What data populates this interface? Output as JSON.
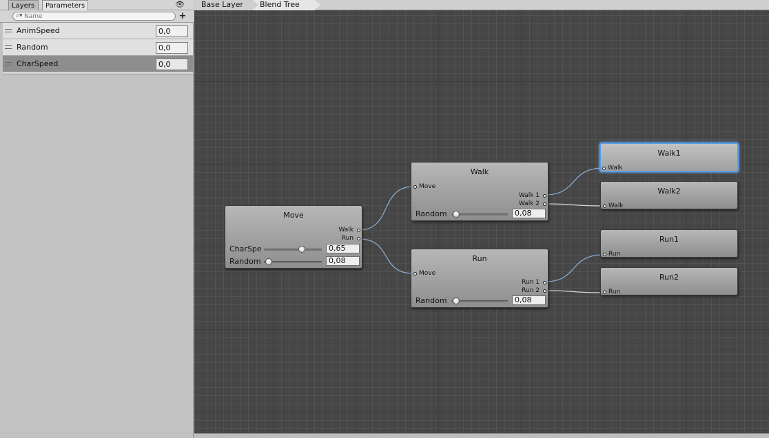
{
  "left_panel": {
    "tabs": {
      "layers": "Layers",
      "parameters": "Parameters"
    },
    "search": {
      "placeholder": "Name"
    },
    "add_button_icon": "plus-icon",
    "parameters": [
      {
        "name": "AnimSpeed",
        "value": "0,0"
      },
      {
        "name": "Random",
        "value": "0,0"
      },
      {
        "name": "CharSpeed",
        "value": "0,0",
        "selected": true
      }
    ]
  },
  "breadcrumb": {
    "base": "Base Layer",
    "blend": "Blend Tree"
  },
  "nodes": {
    "move": {
      "title": "Move",
      "outputs": [
        "Walk",
        "Run"
      ],
      "slider1": {
        "label": "CharSpe",
        "value": "0,65",
        "level": 0.65
      },
      "slider2": {
        "label": "Random",
        "value": "0,08",
        "level": 0.08
      }
    },
    "walk": {
      "title": "Walk",
      "input": "Move",
      "outputs": [
        "Walk 1",
        "Walk 2"
      ],
      "slider": {
        "label": "Random",
        "value": "0,08",
        "level": 0.08
      }
    },
    "run": {
      "title": "Run",
      "input": "Move",
      "outputs": [
        "Run 1",
        "Run 2"
      ],
      "slider": {
        "label": "Random",
        "value": "0,08",
        "level": 0.08
      }
    },
    "walk1": {
      "title": "Walk1",
      "input": "Walk",
      "selected": true
    },
    "walk2": {
      "title": "Walk2",
      "input": "Walk"
    },
    "run1": {
      "title": "Run1",
      "input": "Run"
    },
    "run2": {
      "title": "Run2",
      "input": "Run"
    }
  },
  "colors": {
    "selection": "#5a9ee8",
    "active_connection": "#8ab0d8",
    "inactive_connection": "#d8d8d8",
    "grid": "#464646"
  }
}
